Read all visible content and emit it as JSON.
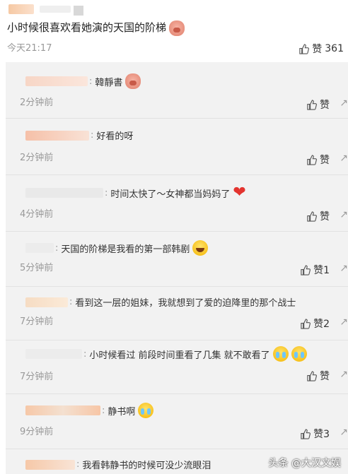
{
  "post": {
    "text": "小时候很喜欢看她演的天国的阶梯",
    "time": "今天21:17",
    "like_label": "赞",
    "like_count": "361",
    "emoji": "pig-face-icon"
  },
  "colors": {
    "comment_bg": "#f2f2f2",
    "meta_gray": "#999999",
    "heart_red": "#e3342f"
  },
  "comments": [
    {
      "text": "韓靜書",
      "time": "2分钟前",
      "like": "赞",
      "emoji": "pig-face-icon"
    },
    {
      "text": "好看的呀",
      "time": "2分钟前",
      "like": "赞"
    },
    {
      "text": "时间太快了～女神都当妈妈了",
      "time": "4分钟前",
      "like": "赞",
      "emoji": "heart-icon"
    },
    {
      "text": "天国的阶梯是我看的第一部韩剧",
      "time": "5分钟前",
      "like": "赞1",
      "emoji": "laugh-cry-icon"
    },
    {
      "text": "看到这一层的姐妹，我就想到了爱的迫降里的那个战士",
      "time": "7分钟前",
      "like": "赞2"
    },
    {
      "text": "小时候看过 前段时间重看了几集 就不敢看了",
      "time": "7分钟前",
      "like": "赞",
      "emoji": "crying-icon"
    },
    {
      "text": "静书啊",
      "time": "9分钟前",
      "like": "赞3",
      "emoji": "crying-icon"
    },
    {
      "text": "我看韩静书的时候可没少流眼泪",
      "time": "",
      "like": ""
    }
  ],
  "watermark": {
    "text": "头条 @大汉文娱"
  }
}
